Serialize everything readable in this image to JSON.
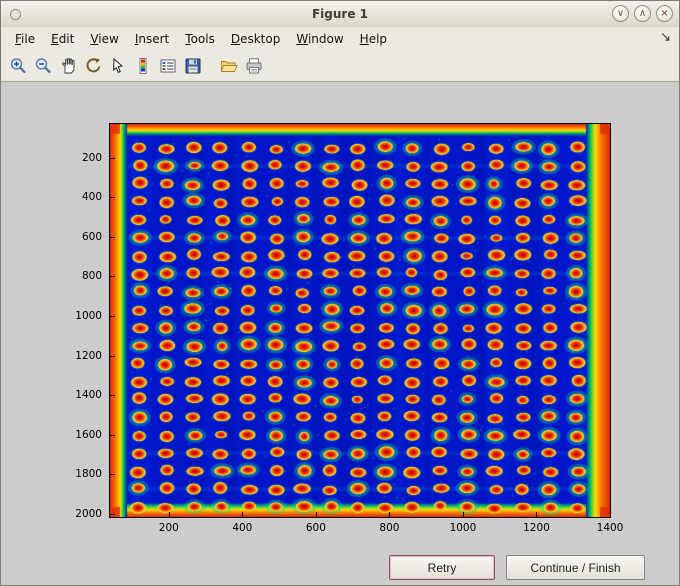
{
  "window": {
    "title": "Figure 1",
    "controls": {
      "minimize": "∨",
      "maximize": "∧",
      "close": "×"
    }
  },
  "menu": {
    "items": [
      {
        "label": "File",
        "mnemonic": "F"
      },
      {
        "label": "Edit",
        "mnemonic": "E"
      },
      {
        "label": "View",
        "mnemonic": "V"
      },
      {
        "label": "Insert",
        "mnemonic": "I"
      },
      {
        "label": "Tools",
        "mnemonic": "T"
      },
      {
        "label": "Desktop",
        "mnemonic": "D"
      },
      {
        "label": "Window",
        "mnemonic": "W"
      },
      {
        "label": "Help",
        "mnemonic": "H"
      }
    ],
    "dock_icon": "↘"
  },
  "toolbar": {
    "icons": [
      {
        "name": "zoom-in"
      },
      {
        "name": "zoom-out"
      },
      {
        "name": "pan"
      },
      {
        "name": "rotate-3d"
      },
      {
        "name": "data-cursor"
      },
      {
        "name": "colorbar"
      },
      {
        "name": "legend"
      },
      {
        "name": "save"
      },
      {
        "name": "open-folder",
        "group": true
      },
      {
        "name": "print"
      }
    ]
  },
  "buttons": {
    "retry": "Retry",
    "continue": "Continue / Finish"
  },
  "chart_data": {
    "type": "heatmap",
    "title": "",
    "description": "Microarray / well-plate scan displayed with jet colormap: deep blue background, regular grid of bright red-orange spots with yellow-green halos, saturated red/orange bands along all four image edges",
    "colormap": "jet",
    "x_range": [
      40,
      1400
    ],
    "y_range": [
      30,
      2015
    ],
    "x_ticks": [
      200,
      400,
      600,
      800,
      1000,
      1200,
      1400
    ],
    "y_ticks": [
      200,
      400,
      600,
      800,
      1000,
      1200,
      1400,
      1600,
      1800,
      2000
    ],
    "grid": {
      "rows": 21,
      "cols": 17,
      "x_start": 119,
      "y_start": 151,
      "x_spacing": 74.5,
      "y_spacing": 90.7,
      "spot_rx_data": 22,
      "spot_ry_data": 28
    },
    "colors": {
      "background": "#0016c8",
      "spot_core": "#b40000",
      "spot_mid": "#ff9400",
      "spot_ring": "#ffe93c",
      "halo": "#00dc8c",
      "edge_hot": "#d42a00",
      "edge_warm": "#ff7a00",
      "edge_yellow": "#ffe000",
      "edge_green": "#00c853"
    }
  }
}
